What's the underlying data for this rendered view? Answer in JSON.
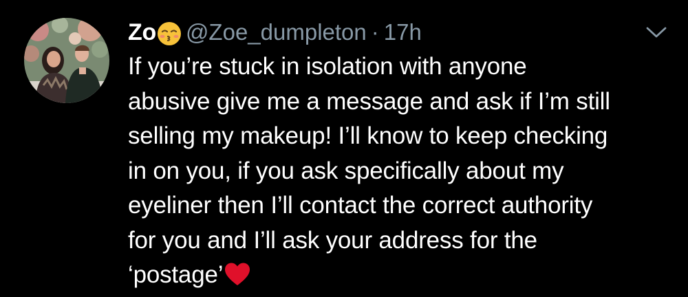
{
  "tweet": {
    "display_name": "Zo",
    "emoji_icon": "kissing-face-with-closed-eyes-icon",
    "handle": "@Zoe_dumpleton",
    "separator": "·",
    "time": "17h",
    "menu_icon": "chevron-down-icon",
    "text_lines": [
      "If you’re stuck in isolation with anyone",
      "abusive give me a message and ask if I’m still",
      "selling my makeup! I’ll know to keep checking",
      "in on you, if you ask specifically about my",
      "eyeliner then I’ll contact the correct authority",
      "for you and I’ll ask your address for the",
      "‘postage’"
    ],
    "trailing_icon": "red-heart-icon"
  },
  "colors": {
    "background": "#000000",
    "text": "#ffffff",
    "muted": "#8899a6",
    "heart": "#e0102a",
    "emoji": "#f7c23a"
  }
}
